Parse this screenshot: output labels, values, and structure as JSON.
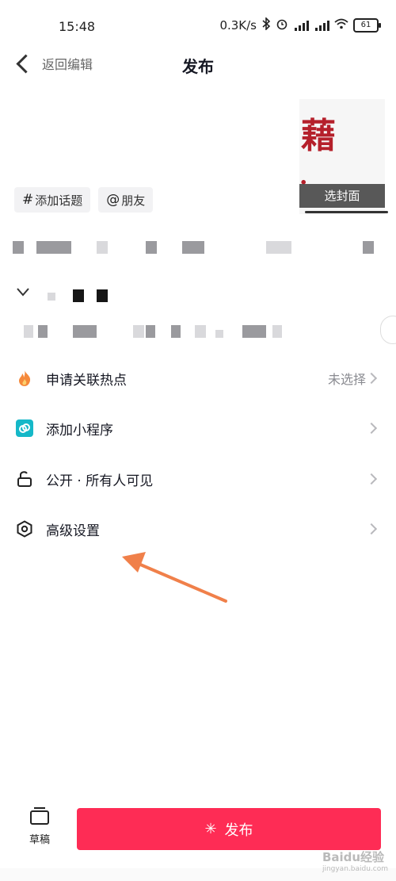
{
  "status_bar": {
    "time": "15:48",
    "net_speed": "0.3K/s",
    "battery": "61"
  },
  "header": {
    "back_label": "返回编辑",
    "title": "发布"
  },
  "cover": {
    "button_label": "选封面",
    "glyph1": "藉",
    "glyph2": "."
  },
  "chips": [
    {
      "symbol": "#",
      "label": "添加话题"
    },
    {
      "symbol": "@",
      "label": "朋友"
    }
  ],
  "settings": [
    {
      "label": "申请关联热点",
      "value": "未选择",
      "icon": "fire-icon"
    },
    {
      "label": "添加小程序",
      "value": "",
      "icon": "mini-program-icon"
    },
    {
      "label": "公开 · 所有人可见",
      "value": "",
      "icon": "unlock-icon"
    },
    {
      "label": "高级设置",
      "value": "",
      "icon": "settings-hexagon-icon"
    }
  ],
  "bottom": {
    "draft_label": "草稿",
    "publish_label": "发布"
  },
  "watermark": {
    "brand": "Baidu经验",
    "url": "jingyan.baidu.com"
  },
  "colors": {
    "publish": "#fe2c55",
    "annotation_arrow": "#f0804a",
    "mini_program": "#15b8c8",
    "fire": "#f5893a"
  }
}
